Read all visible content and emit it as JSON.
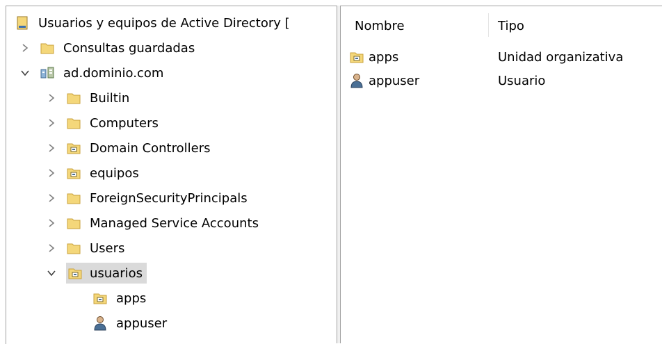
{
  "tree": {
    "root": {
      "label": "Usuarios y equipos de Active Directory [",
      "icon": "ad-console-icon"
    },
    "saved_queries": {
      "label": "Consultas guardadas",
      "icon": "folder-icon"
    },
    "domain": {
      "label": "ad.dominio.com",
      "icon": "domain-icon"
    },
    "children": [
      {
        "label": "Builtin",
        "icon": "folder-icon"
      },
      {
        "label": "Computers",
        "icon": "folder-icon"
      },
      {
        "label": "Domain Controllers",
        "icon": "ou-icon"
      },
      {
        "label": "equipos",
        "icon": "ou-icon"
      },
      {
        "label": "ForeignSecurityPrincipals",
        "icon": "folder-icon"
      },
      {
        "label": "Managed Service Accounts",
        "icon": "folder-icon"
      },
      {
        "label": "Users",
        "icon": "folder-icon"
      },
      {
        "label": "usuarios",
        "icon": "ou-icon",
        "selected": true
      }
    ],
    "usuarios_children": [
      {
        "label": "apps",
        "icon": "ou-icon"
      },
      {
        "label": "appuser",
        "icon": "user-icon"
      }
    ]
  },
  "list": {
    "columns": [
      "Nombre",
      "Tipo"
    ],
    "rows": [
      {
        "name": "apps",
        "type": "Unidad organizativa",
        "icon": "ou-icon"
      },
      {
        "name": "appuser",
        "type": "Usuario",
        "icon": "user-icon"
      }
    ]
  },
  "colors": {
    "folder": "#f4d77a",
    "selection": "#dadada",
    "chevron": "#808080"
  }
}
